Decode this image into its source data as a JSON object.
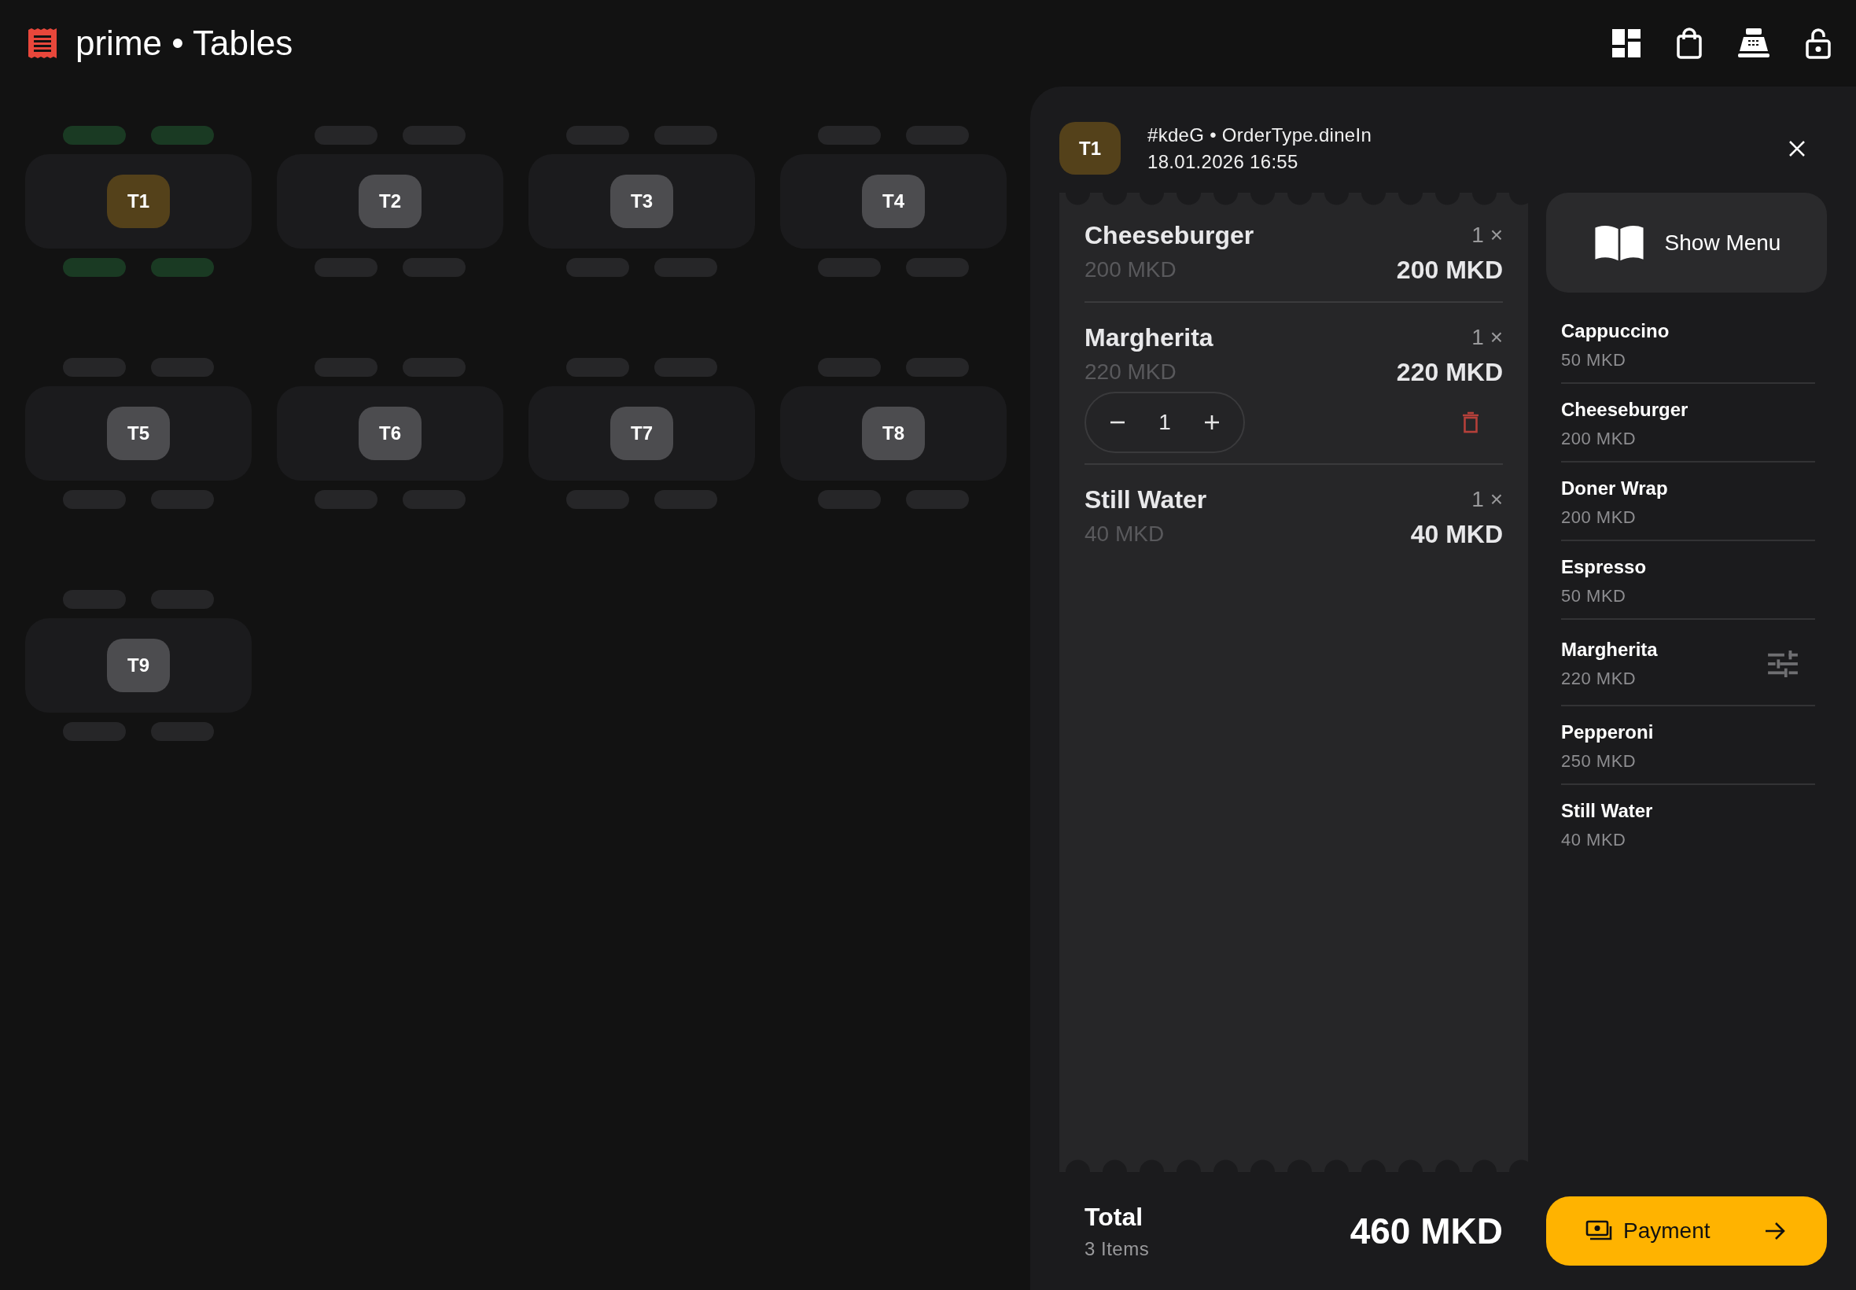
{
  "header": {
    "title": "prime • Tables"
  },
  "tables": [
    {
      "label": "T1",
      "occupied": true
    },
    {
      "label": "T2",
      "occupied": false
    },
    {
      "label": "T3",
      "occupied": false
    },
    {
      "label": "T4",
      "occupied": false
    },
    {
      "label": "T5",
      "occupied": false
    },
    {
      "label": "T6",
      "occupied": false
    },
    {
      "label": "T7",
      "occupied": false
    },
    {
      "label": "T8",
      "occupied": false
    },
    {
      "label": "T9",
      "occupied": false
    }
  ],
  "order": {
    "table": "T1",
    "info": "#kdeG • OrderType.dineIn",
    "timestamp": "18.01.2026 16:55",
    "items": [
      {
        "name": "Cheeseburger",
        "unit_price": "200 MKD",
        "quantity": "1 ×",
        "line_total": "200 MKD",
        "expanded": false
      },
      {
        "name": "Margherita",
        "unit_price": "220 MKD",
        "quantity": "1 ×",
        "line_total": "220 MKD",
        "expanded": true,
        "stepper_value": "1"
      },
      {
        "name": "Still Water",
        "unit_price": "40 MKD",
        "quantity": "1 ×",
        "line_total": "40 MKD",
        "expanded": false
      }
    ],
    "total_label": "Total",
    "item_count": "3 Items",
    "total": "460 MKD"
  },
  "menu": {
    "button": "Show Menu",
    "items": [
      {
        "name": "Cappuccino",
        "price": "50 MKD",
        "has_options": false
      },
      {
        "name": "Cheeseburger",
        "price": "200 MKD",
        "has_options": false
      },
      {
        "name": "Doner Wrap",
        "price": "200 MKD",
        "has_options": false
      },
      {
        "name": "Espresso",
        "price": "50 MKD",
        "has_options": false
      },
      {
        "name": "Margherita",
        "price": "220 MKD",
        "has_options": true
      },
      {
        "name": "Pepperoni",
        "price": "250 MKD",
        "has_options": false
      },
      {
        "name": "Still Water",
        "price": "40 MKD",
        "has_options": false
      }
    ]
  },
  "payment_button": "Payment"
}
